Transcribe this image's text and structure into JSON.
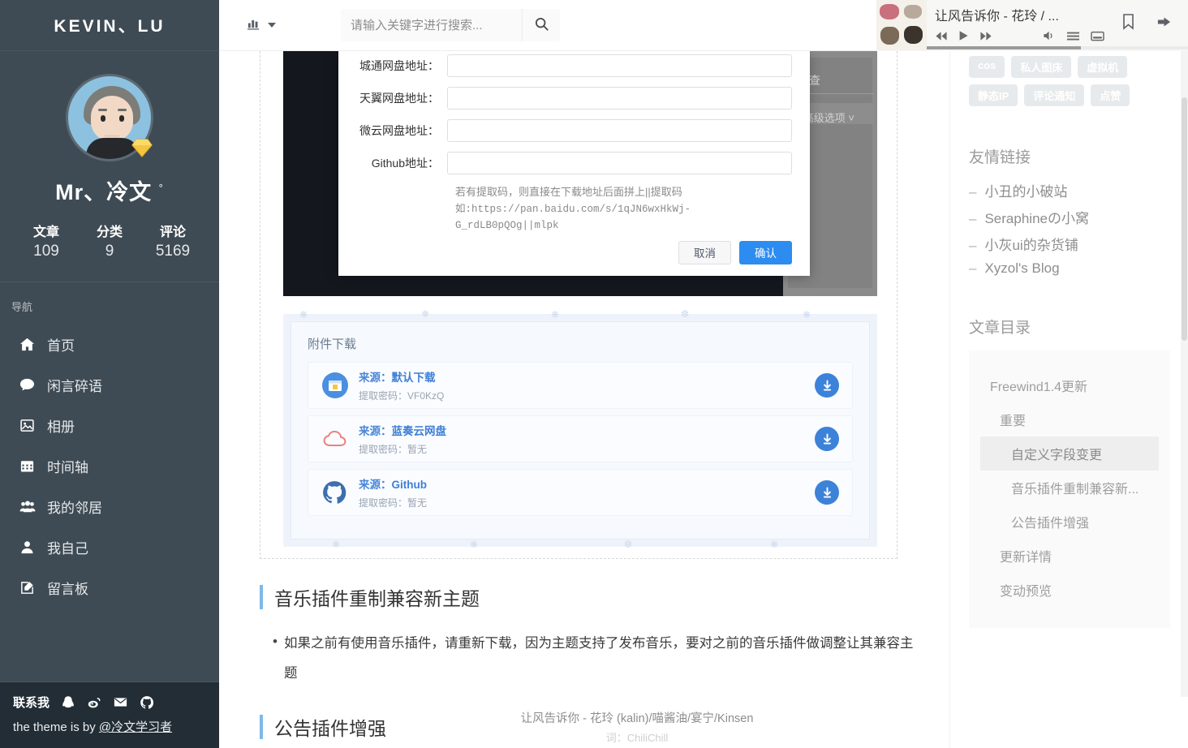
{
  "sidebar": {
    "brand": "KEVIN、LU",
    "profile": {
      "nickname": "Mr、冷文",
      "degree": "°",
      "stats": [
        {
          "label": "文章",
          "value": "109"
        },
        {
          "label": "分类",
          "value": "9"
        },
        {
          "label": "评论",
          "value": "5169"
        }
      ]
    },
    "nav_title": "导航",
    "nav_items": [
      {
        "icon": "home-icon",
        "label": "首页"
      },
      {
        "icon": "comment-icon",
        "label": "闲言碎语"
      },
      {
        "icon": "photo-icon",
        "label": "相册"
      },
      {
        "icon": "calendar-icon",
        "label": "时间轴"
      },
      {
        "icon": "users-icon",
        "label": "我的邻居"
      },
      {
        "icon": "user-icon",
        "label": "我自己"
      },
      {
        "icon": "edit-icon",
        "label": "留言板"
      }
    ],
    "contact": {
      "label": "联系我",
      "icons": [
        "qq-icon",
        "weibo-icon",
        "mail-icon",
        "github-icon"
      ],
      "theme_prefix": "the theme is by ",
      "theme_author": "@冷文学习者"
    }
  },
  "topbar": {
    "chart_menu_icon": "chart-bar-icon",
    "search": {
      "placeholder": "请输入关键字进行搜索...",
      "value": "",
      "button_icon": "search-icon"
    }
  },
  "player": {
    "track": "让风告诉你 - 花玲 / ...",
    "controls": [
      "prev-icon",
      "play-icon",
      "next-icon",
      "volume-icon",
      "playlist-icon",
      "lyrics-icon"
    ],
    "right_icons": [
      "bookmark-icon",
      "login-icon"
    ],
    "progress_percent": 59
  },
  "modal": {
    "fields": [
      {
        "label": "城通网盘地址：",
        "value": "",
        "name": "chengtong-url-input"
      },
      {
        "label": "天翼网盘地址：",
        "value": "",
        "name": "tianyi-url-input"
      },
      {
        "label": "微云网盘地址：",
        "value": "",
        "name": "weiyun-url-input"
      },
      {
        "label": "Github地址：",
        "value": "",
        "name": "github-url-input"
      }
    ],
    "hint_line1": "若有提取码，则直接在下载地址后面拼上||提取码",
    "hint_line2": "如:https://pan.baidu.com/s/1qJN6wxHkWj-G_rdLB0pQOg||mlpk",
    "cancel_label": "取消",
    "confirm_label": "确认",
    "confirm_color": "#2d8cf0"
  },
  "screenshot_bg": {
    "gray_text_1": "查",
    "gray_text_2": "高级选项 ˅"
  },
  "attachment": {
    "title": "附件下载",
    "rows": [
      {
        "icon": "folder-blue-icon",
        "source_label": "来源：",
        "source_name": "默认下载",
        "password_label": "提取密码：",
        "password": "VF0KzQ",
        "download_icon": "download-icon"
      },
      {
        "icon": "lanzou-cloud-icon",
        "source_label": "来源：",
        "source_name": "蓝奏云网盘",
        "password_label": "提取密码：",
        "password": "暂无",
        "download_icon": "download-icon"
      },
      {
        "icon": "github-icon",
        "source_label": "来源：",
        "source_name": "Github",
        "password_label": "提取密码：",
        "password": "暂无",
        "download_icon": "download-icon"
      }
    ]
  },
  "article": {
    "heading_1": "音乐插件重制兼容新主题",
    "bullet_1": "如果之前有使用音乐插件，请重新下载，因为主题支持了发布音乐，要对之前的音乐插件做调整让其兼容主题",
    "heading_2": "公告插件增强"
  },
  "lyrics": {
    "main": "让风告诉你 - 花玲 (kalin)/喵酱油/宴宁/Kinsen",
    "sub": "词：ChiliChill"
  },
  "rightbar": {
    "tags": [
      "cos",
      "私人图床",
      "虚拟机",
      "静态IP",
      "评论通知",
      "点赞"
    ],
    "links_title": "友情链接",
    "links": [
      "小丑的小破站",
      "Seraphineの小窝",
      "小灰ui的杂货铺",
      "Xyzol's Blog"
    ],
    "toc_title": "文章目录",
    "toc": [
      {
        "label": "Freewind1.4更新",
        "level": 1,
        "active": false
      },
      {
        "label": "重要",
        "level": 2,
        "active": false
      },
      {
        "label": "自定义字段变更",
        "level": 3,
        "active": true
      },
      {
        "label": "音乐插件重制兼容新...",
        "level": 3,
        "active": false
      },
      {
        "label": "公告插件增强",
        "level": 3,
        "active": false
      },
      {
        "label": "更新详情",
        "level": 2,
        "active": false
      },
      {
        "label": "变动预览",
        "level": 2,
        "active": false
      }
    ]
  },
  "colors": {
    "sidebar_bg": "#3f4b54",
    "contact_bg": "#222d35",
    "accent_blue": "#2d8cf0",
    "heading_bar": "#7db9e8",
    "link_blue": "#3f7fd6"
  }
}
